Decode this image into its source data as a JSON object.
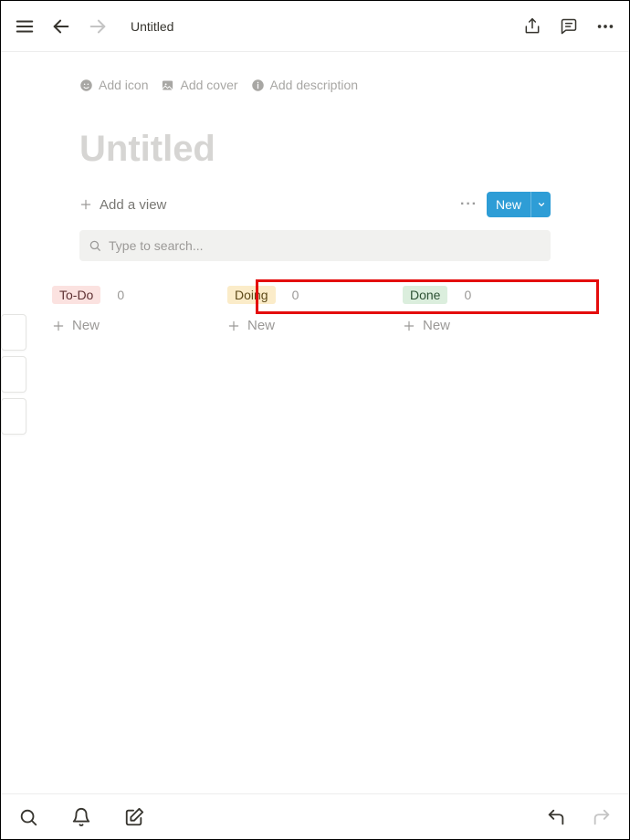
{
  "topbar": {
    "title": "Untitled"
  },
  "page_options": {
    "add_icon": "Add icon",
    "add_cover": "Add cover",
    "add_description": "Add description"
  },
  "page_heading": "Untitled",
  "view_row": {
    "add_view": "Add a view",
    "new_button": "New"
  },
  "search": {
    "placeholder": "Type to search..."
  },
  "board": {
    "columns": [
      {
        "label": "To-Do",
        "count": "0",
        "tag_class": "tag-todo",
        "new_label": "New"
      },
      {
        "label": "Doing",
        "count": "0",
        "tag_class": "tag-doing",
        "new_label": "New"
      },
      {
        "label": "Done",
        "count": "0",
        "tag_class": "tag-done",
        "new_label": "New"
      }
    ]
  },
  "colors": {
    "accent": "#2e9dd6",
    "highlight": "#e40c0c"
  }
}
